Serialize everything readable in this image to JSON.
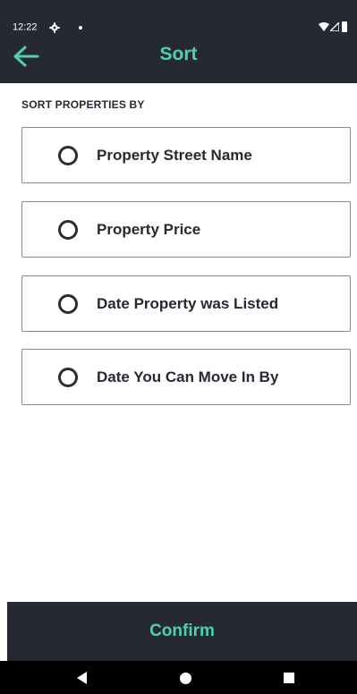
{
  "status_bar": {
    "time": "12:22"
  },
  "app_bar": {
    "title": "Sort",
    "back_icon": "arrow-left-icon"
  },
  "section_label": "SORT PROPERTIES BY",
  "options": [
    {
      "label": "Property Street Name",
      "selected": false
    },
    {
      "label": "Property Price",
      "selected": false
    },
    {
      "label": "Date Property was Listed",
      "selected": false
    },
    {
      "label": "Date You Can Move In By",
      "selected": false
    }
  ],
  "confirm_label": "Confirm",
  "colors": {
    "bar_background": "#272932",
    "accent": "#4fd1ab",
    "text": "#272932"
  }
}
